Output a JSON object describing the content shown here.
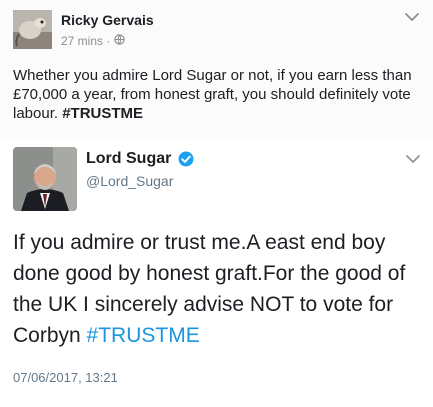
{
  "facebook_post": {
    "author": "Ricky Gervais",
    "time": "27 mins",
    "separator": "·",
    "privacy_icon": "globe-icon",
    "menu_icon": "chevron-down-icon",
    "text": "Whether you admire Lord Sugar or not, if you earn less than £70,000 a year, from honest graft, you should definitely vote labour.",
    "hashtag": "#TRUSTME"
  },
  "tweet": {
    "author": "Lord Sugar",
    "verified_icon": "verified-badge-icon",
    "handle": "@Lord_Sugar",
    "menu_icon": "chevron-down-icon",
    "text": "If you admire or trust me.A east end boy done good by honest graft.For the good of the UK I sincerely advise NOT to vote for Corbyn",
    "hashtag": "#TRUSTME",
    "timestamp": "07/06/2017, 13:21"
  },
  "colors": {
    "link": "#1b95e0",
    "verified": "#1da1f2",
    "muted": "#657786"
  }
}
